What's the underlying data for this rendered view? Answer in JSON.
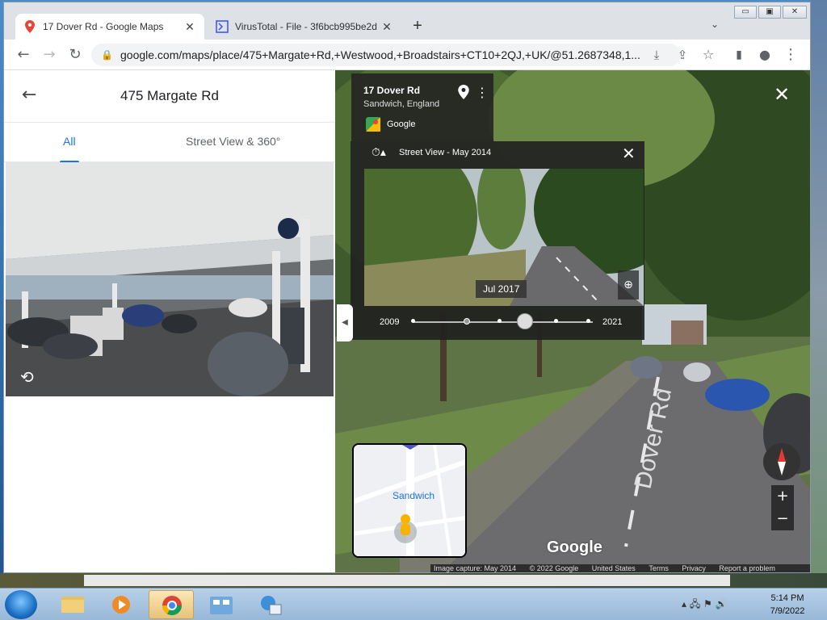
{
  "browser": {
    "tabs": [
      {
        "title": "17 Dover Rd - Google Maps",
        "active": true
      },
      {
        "title": "VirusTotal - File - 3f6bcb995be2d",
        "active": false
      }
    ],
    "url": "google.com/maps/place/475+Margate+Rd,+Westwood,+Broadstairs+CT10+2QJ,+UK/@51.2687348,1...",
    "window_controls": [
      "minimize",
      "restore",
      "close"
    ]
  },
  "panel": {
    "title": "475 Margate Rd",
    "tabs": [
      "All",
      "Street View & 360°"
    ],
    "selected_tab": "All"
  },
  "streetview": {
    "address_title": "17 Dover Rd",
    "address_subtitle": "Sandwich, England",
    "provider": "Google",
    "timeline": {
      "title": "Street View - May 2014",
      "date_badge": "Jul 2017",
      "year_start": "2009",
      "year_end": "2021"
    },
    "minimap_label": "Sandwich",
    "watermark": "Google",
    "road_label": "Dover Rd",
    "footer": [
      "Image capture: May 2014",
      "© 2022 Google",
      "United States",
      "Terms",
      "Privacy",
      "Report a problem"
    ]
  },
  "taskbar": {
    "time": "5:14 PM",
    "date": "7/9/2022"
  },
  "colors": {
    "accent": "#1a73e8",
    "overlay": "#222222"
  }
}
